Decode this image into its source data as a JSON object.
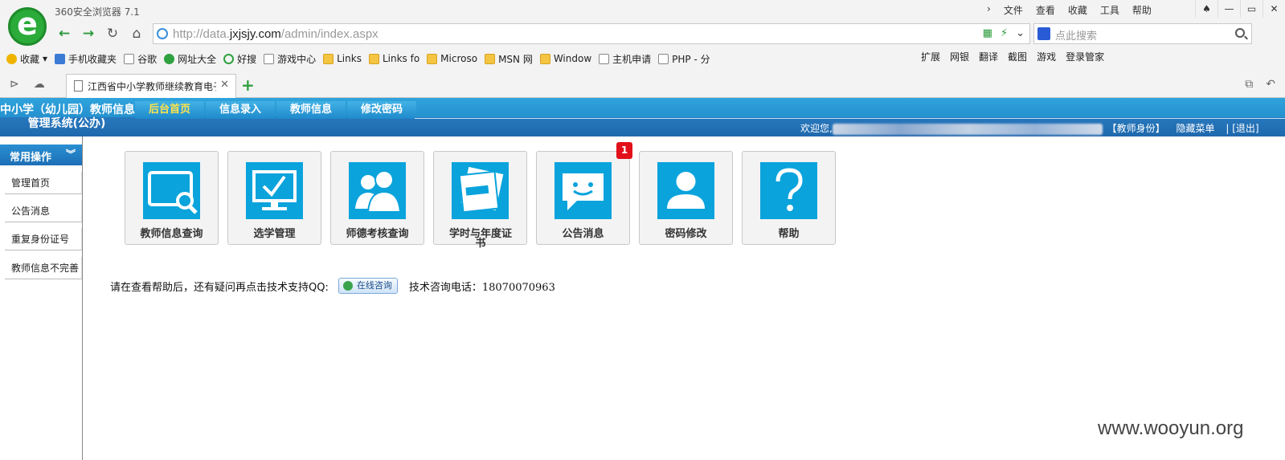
{
  "browser": {
    "title": "360安全浏览器 7.1",
    "top_menu": [
      "文件",
      "查看",
      "收藏",
      "工具",
      "帮助"
    ],
    "url_prefix": "http://data.",
    "url_domain": "jxjsjy.com",
    "url_path": "/admin/index.aspx",
    "search_placeholder": "点此搜索",
    "bookmarks": [
      {
        "label": "收藏",
        "icon": "star"
      },
      {
        "label": "手机收藏夹",
        "icon": "blue"
      },
      {
        "label": "谷歌",
        "icon": "page"
      },
      {
        "label": "网址大全",
        "icon": "green"
      },
      {
        "label": "好搜",
        "icon": "ring"
      },
      {
        "label": "游戏中心",
        "icon": "page"
      },
      {
        "label": "Links",
        "icon": "folder"
      },
      {
        "label": "Links fo",
        "icon": "folder"
      },
      {
        "label": "Microso",
        "icon": "folder"
      },
      {
        "label": "MSN 网",
        "icon": "folder"
      },
      {
        "label": "Window",
        "icon": "folder"
      },
      {
        "label": "主机申请",
        "icon": "page"
      },
      {
        "label": "PHP - 分",
        "icon": "page"
      }
    ],
    "toolbar_right": [
      "扩展",
      "网银",
      "翻译",
      "截图",
      "游戏",
      "登录管家"
    ],
    "tab_title": "江西省中小学教师继续教育电子"
  },
  "header": {
    "system_title_line1": "中小学（幼儿园）教师信息",
    "system_title_line2": "管理系统(公办)",
    "nav": [
      "后台首页",
      "信息录入",
      "教师信息",
      "修改密码"
    ],
    "welcome": "欢迎您,",
    "links": [
      "【教师身份】",
      "隐藏菜单",
      "|",
      "[退出]"
    ]
  },
  "sidebar": {
    "heading": "常用操作",
    "items": [
      "管理首页",
      "公告消息",
      "重复身份证号",
      "教师信息不完善"
    ]
  },
  "tiles": [
    {
      "label": "教师信息查询",
      "icon": "search-screen-icon"
    },
    {
      "label": "选学管理",
      "icon": "monitor-check-icon"
    },
    {
      "label": "师德考核查询",
      "icon": "users-icon"
    },
    {
      "label": "学时与年度证书",
      "icon": "papers-icon"
    },
    {
      "label": "公告消息",
      "icon": "chat-bubble-icon"
    },
    {
      "label": "密码修改",
      "icon": "user-icon"
    },
    {
      "label": "帮助",
      "icon": "question-icon"
    }
  ],
  "badge_count": "1",
  "help": {
    "text": "请在查看帮助后，还有疑问再点击技术支持QQ:",
    "qq_button": "在线咨询",
    "phone": "技术咨询电话：18070070963"
  },
  "watermark": "www.wooyun.org",
  "colors": {
    "header_blue": "#1a7fc3",
    "tile_icon_blue": "#0aa3dc",
    "badge_red": "#e2101a",
    "nav_active": "#ffe34a"
  }
}
